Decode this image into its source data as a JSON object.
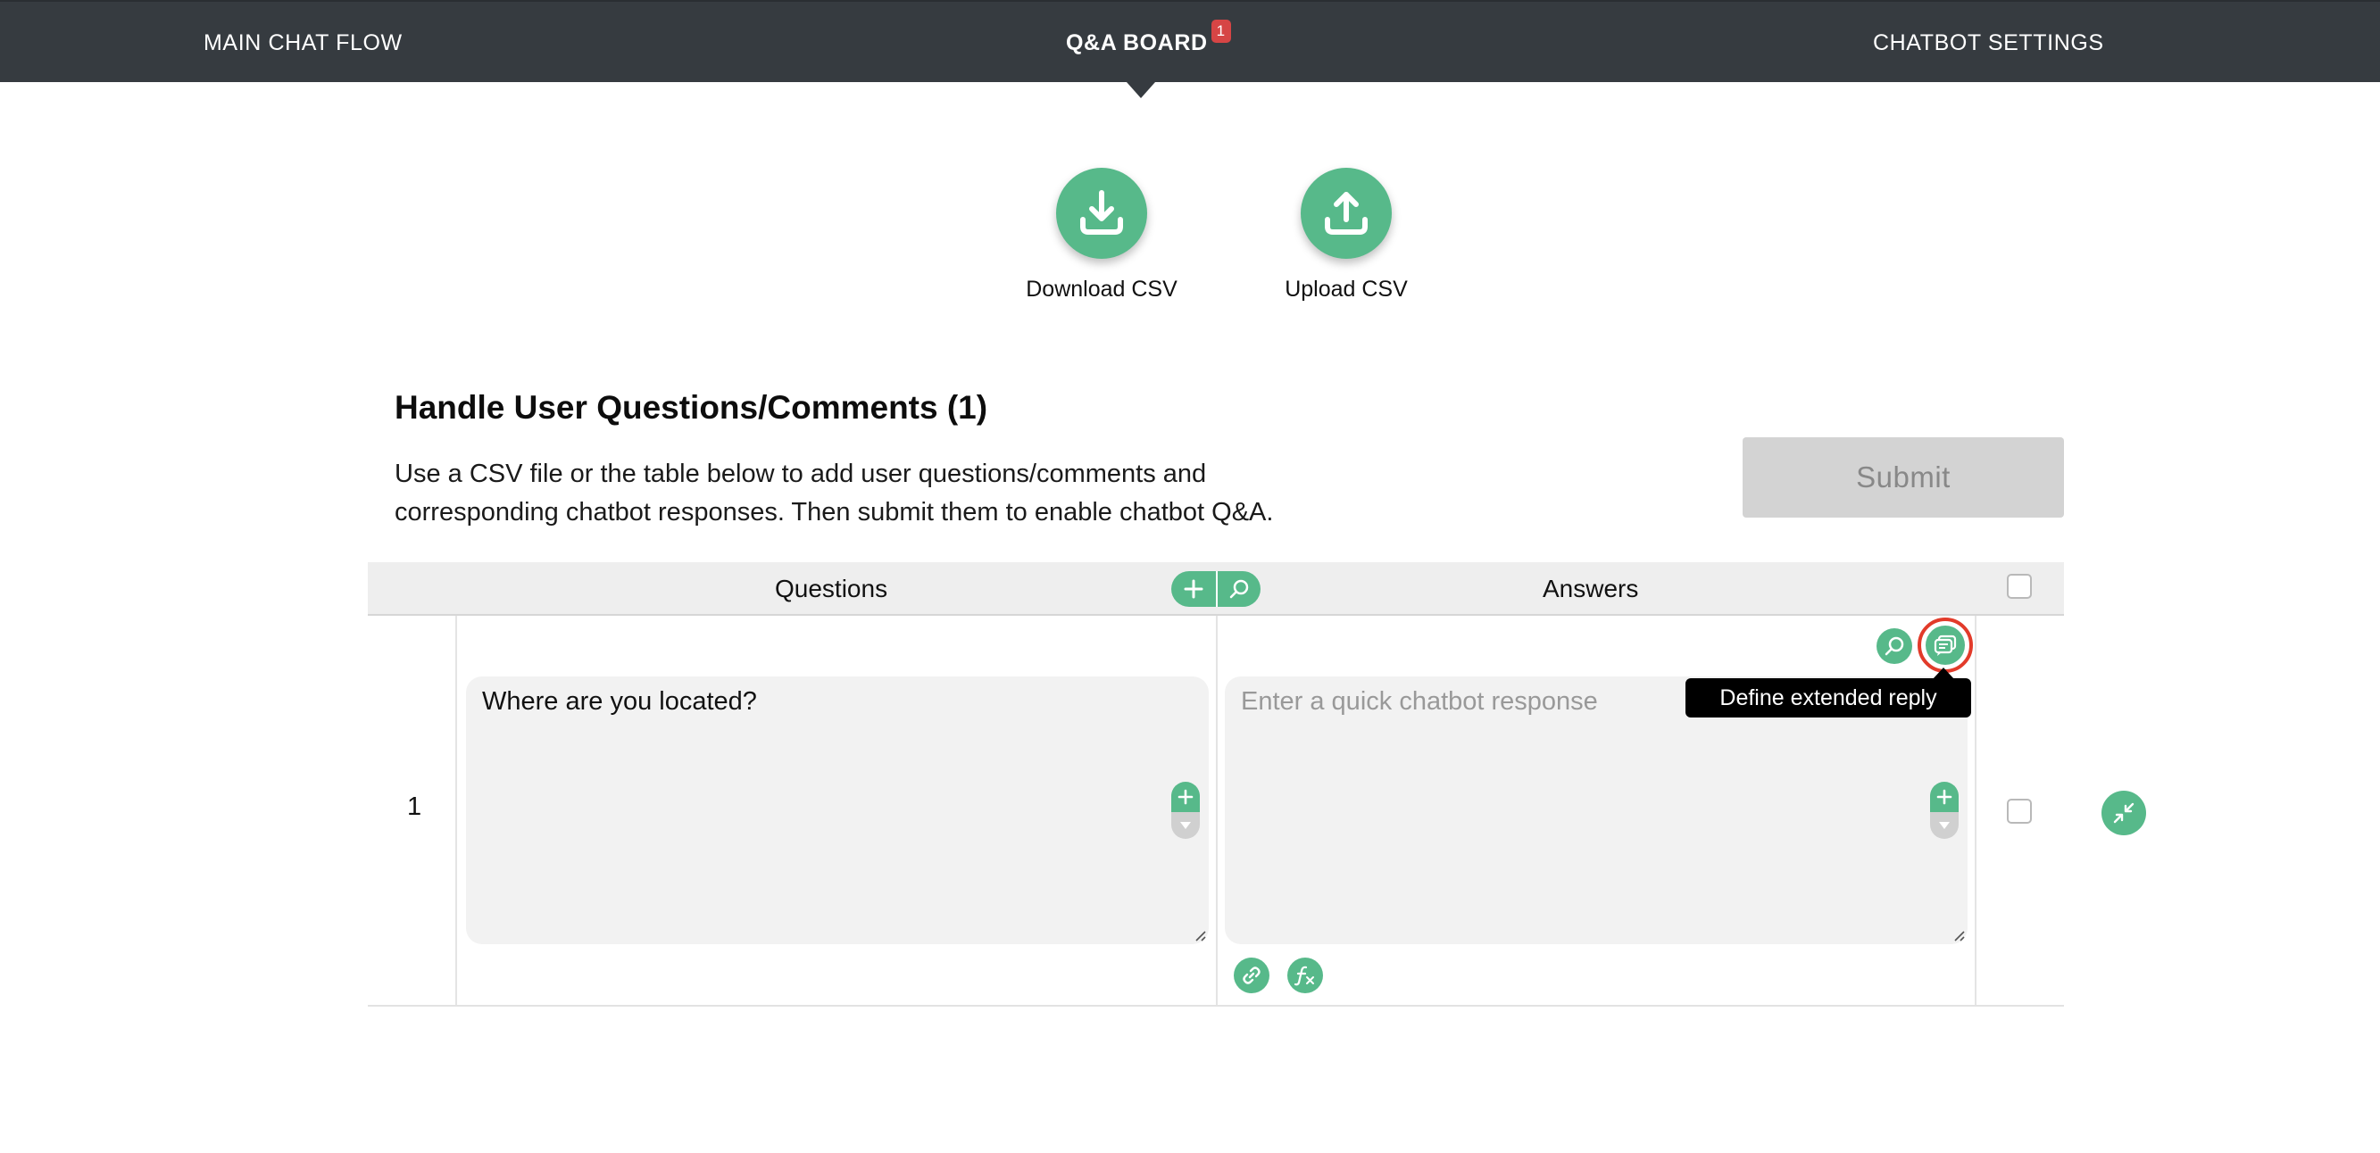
{
  "nav": {
    "items": [
      {
        "label": "MAIN CHAT FLOW"
      },
      {
        "label": "Q&A BOARD",
        "badge": "1"
      },
      {
        "label": "CHATBOT SETTINGS"
      }
    ]
  },
  "csv": {
    "download_label": "Download CSV",
    "upload_label": "Upload CSV"
  },
  "section": {
    "title": "Handle User Questions/Comments (1)",
    "description": "Use a CSV file or the table below to add user questions/comments and corresponding chatbot responses. Then submit them to enable chatbot Q&A.",
    "submit_label": "Submit"
  },
  "table": {
    "questions_header": "Questions",
    "answers_header": "Answers",
    "rows": [
      {
        "number": "1",
        "question": "Where are you located?",
        "answer_placeholder": "Enter a quick chatbot response"
      }
    ]
  },
  "tooltip": {
    "text": "Define extended reply"
  },
  "colors": {
    "navbar": "#363b40",
    "accent": "#57b98a",
    "badge": "#d64545",
    "highlight": "#e23b2a",
    "submit_disabled": "#d3d3d3"
  }
}
